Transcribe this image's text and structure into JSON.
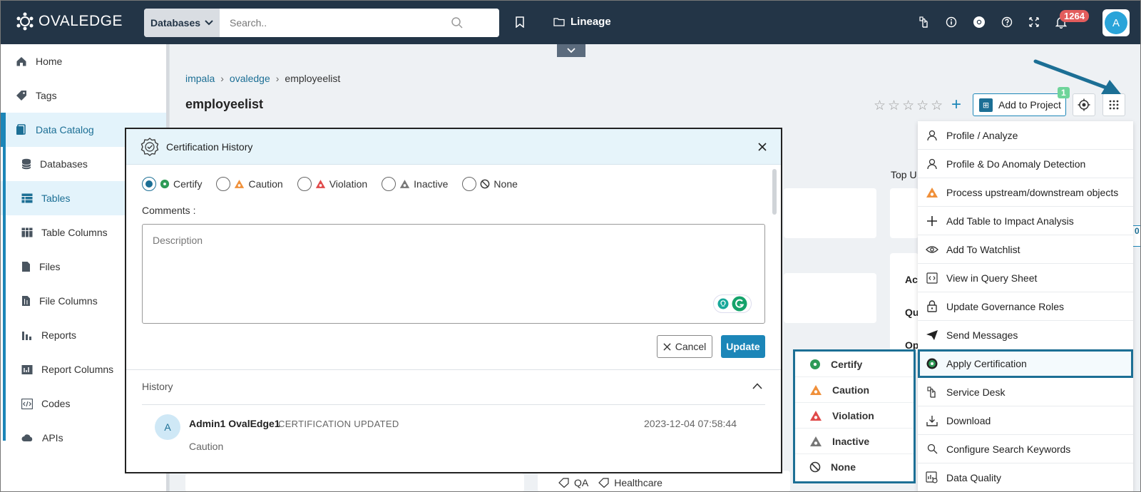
{
  "app": {
    "name": "OVALEDGE"
  },
  "header": {
    "search_type": "Databases",
    "search_placeholder": "Search..",
    "lineage_label": "Lineage",
    "notification_count": "1264",
    "user_initial": "A"
  },
  "sidebar": {
    "items": [
      {
        "label": "Home"
      },
      {
        "label": "Tags"
      },
      {
        "label": "Data Catalog"
      },
      {
        "label": "Databases"
      },
      {
        "label": "Tables"
      },
      {
        "label": "Table Columns"
      },
      {
        "label": "Files"
      },
      {
        "label": "File Columns"
      },
      {
        "label": "Reports"
      },
      {
        "label": "Report Columns"
      },
      {
        "label": "Codes"
      },
      {
        "label": "APIs"
      }
    ]
  },
  "breadcrumb": {
    "items": [
      "impala",
      "ovaledge"
    ],
    "current": "employeelist"
  },
  "page": {
    "title": "employeelist",
    "add_to_project_label": "Add to Project",
    "project_count": "1",
    "bg_label_top": "Top U",
    "bg_label_ac": "Ac",
    "bg_label_qu": "Qu",
    "bg_label_op": "Op",
    "bg_side_count": "0"
  },
  "menu": {
    "items": [
      {
        "label": "Profile / Analyze"
      },
      {
        "label": "Profile & Do Anomaly Detection"
      },
      {
        "label": "Process upstream/downstream objects"
      },
      {
        "label": "Add Table to Impact Analysis"
      },
      {
        "label": "Add To Watchlist"
      },
      {
        "label": "View in Query Sheet"
      },
      {
        "label": "Update Governance Roles"
      },
      {
        "label": "Send Messages"
      },
      {
        "label": "Apply Certification"
      },
      {
        "label": "Service Desk"
      },
      {
        "label": "Download"
      },
      {
        "label": "Configure Search Keywords"
      },
      {
        "label": "Data Quality"
      }
    ]
  },
  "cert_submenu": {
    "items": [
      {
        "label": "Certify"
      },
      {
        "label": "Caution"
      },
      {
        "label": "Violation"
      },
      {
        "label": "Inactive"
      },
      {
        "label": "None"
      }
    ]
  },
  "modal": {
    "title": "Certification History",
    "options": [
      "Certify",
      "Caution",
      "Violation",
      "Inactive",
      "None"
    ],
    "selected": "Certify",
    "comments_label": "Comments :",
    "description_placeholder": "Description",
    "cancel_label": "Cancel",
    "update_label": "Update",
    "history_label": "History",
    "history": [
      {
        "initial": "A",
        "user": "Admin1 OvalEdge1",
        "action": "CERTIFICATION UPDATED",
        "date": "2023-12-04 07:58:44",
        "value": "Caution"
      }
    ]
  },
  "tags": [
    "QA",
    "Healthcare"
  ],
  "colors": {
    "topbar": "#233547",
    "accent": "#1c86b8",
    "certify": "#2e9b57",
    "caution": "#f0903a",
    "violation": "#e04a4a",
    "inactive": "#777777"
  }
}
